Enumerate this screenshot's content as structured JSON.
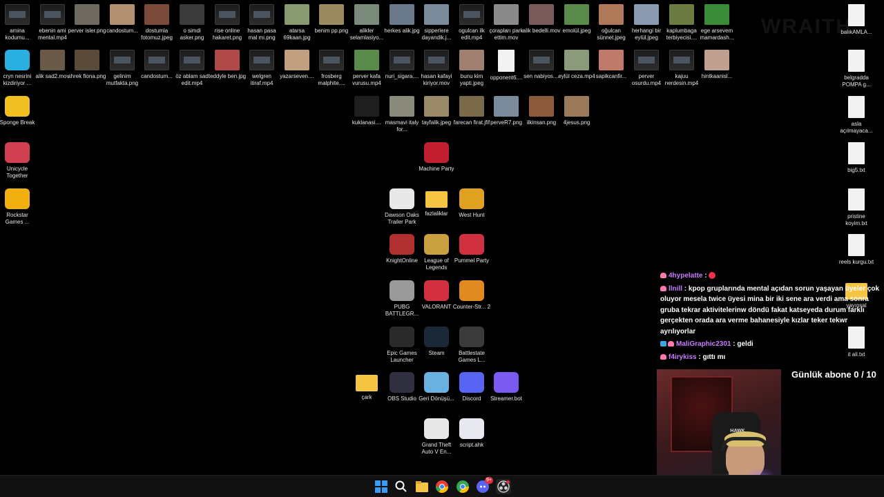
{
  "desktop_icons": [
    {
      "label": "amina kodumu...",
      "type": "vid",
      "color": ""
    },
    {
      "label": "ebenin ami mental.mp4",
      "type": "vid",
      "color": ""
    },
    {
      "label": "perver isler.png",
      "type": "photo",
      "color": "#6f6a60"
    },
    {
      "label": "candostum...",
      "type": "photo",
      "color": "#b09070"
    },
    {
      "label": "dostumla fotomuz.jpeg",
      "type": "photo",
      "color": "#7a4a3a"
    },
    {
      "label": "o simdi asker.png",
      "type": "photo",
      "color": "#3a3a3a"
    },
    {
      "label": "rise online hakaret.png",
      "type": "vid",
      "color": ""
    },
    {
      "label": "hasan pasa mal mi.png",
      "type": "vid",
      "color": ""
    },
    {
      "label": "atarsa 69kaan.jpg",
      "type": "photo",
      "color": "#8a9a70"
    },
    {
      "label": "benim pp.png",
      "type": "photo",
      "color": "#9a8a60"
    },
    {
      "label": "alikler selamlasiyo...",
      "type": "photo",
      "color": "#7a8a7a"
    },
    {
      "label": "herkes alik.jpg",
      "type": "photo",
      "color": "#6a7a8a"
    },
    {
      "label": "sipperlere dayandik.j...",
      "type": "photo",
      "color": "#7a8a9a"
    },
    {
      "label": "ogulcan ilk edit.mp4",
      "type": "vid",
      "color": ""
    },
    {
      "label": "çorapları park ettim.mov",
      "type": "photo",
      "color": "#8a8a8a"
    },
    {
      "label": "alik bedelli.mov",
      "type": "photo",
      "color": "#7a5a5a"
    },
    {
      "label": "emolül.jpeg",
      "type": "photo",
      "color": "#5a8a4a"
    },
    {
      "label": "oğulcan sünnet.jpeg",
      "type": "photo",
      "color": "#b07a5a"
    },
    {
      "label": "herhangi bir eylül.jpeg",
      "type": "photo",
      "color": "#8a9ab0"
    },
    {
      "label": "kaplumbaga terbiyecisi....",
      "type": "photo",
      "color": "#6a7a40"
    },
    {
      "label": "ege arsevem mamardash...",
      "type": "photo",
      "color": "#3a8a3a"
    },
    {
      "label": "cryn nesrini kizdiriyor ...",
      "type": "app",
      "color": "#2ab0e0"
    },
    {
      "label": "alik sad2.mov",
      "type": "photo",
      "color": "#6a5a4a"
    },
    {
      "label": "shrek fiona.png",
      "type": "photo",
      "color": "#5a4a3a"
    },
    {
      "label": "gelinim mutfakta.png",
      "type": "vid",
      "color": ""
    },
    {
      "label": "candostum...",
      "type": "vid",
      "color": ""
    },
    {
      "label": "öz ablam sad edit.mp4",
      "type": "vid",
      "color": ""
    },
    {
      "label": "teddyle ben.jpg",
      "type": "photo",
      "color": "#b04a4a"
    },
    {
      "label": "welgren itiraf.mp4",
      "type": "vid",
      "color": ""
    },
    {
      "label": "yazarseven....",
      "type": "photo",
      "color": "#c0a080"
    },
    {
      "label": "frosberg malphite....",
      "type": "vid",
      "color": ""
    },
    {
      "label": "perver kafa vurusu.mp4",
      "type": "photo",
      "color": "#5a8a4a"
    },
    {
      "label": "nuri_sigara....",
      "type": "vid",
      "color": ""
    },
    {
      "label": "hasan kafayi kiriyor.mov",
      "type": "vid",
      "color": ""
    },
    {
      "label": "bunu kim yapti.jpeg",
      "type": "photo",
      "color": "#a08070"
    },
    {
      "label": "opponent6....",
      "type": "txt",
      "color": ""
    },
    {
      "label": "sen nabiyos....",
      "type": "vid",
      "color": ""
    },
    {
      "label": "eylül ceza.mp4",
      "type": "photo",
      "color": "#8a9a7a"
    },
    {
      "label": "sapikcanfir...",
      "type": "photo",
      "color": "#c07a6a"
    },
    {
      "label": "perver osurdu.mp4",
      "type": "vid",
      "color": ""
    },
    {
      "label": "kajuu nerdesin.mp4",
      "type": "vid",
      "color": ""
    },
    {
      "label": "hintkaanisl...",
      "type": "photo",
      "color": "#c0a090"
    },
    {
      "label": "kuklanasi....",
      "type": "photo",
      "color": "#1e1e1e"
    },
    {
      "label": "masmavi italy for...",
      "type": "photo",
      "color": "#8a8a7a"
    },
    {
      "label": "tayfalik.jpeg",
      "type": "photo",
      "color": "#9a8a6a"
    },
    {
      "label": "farecan firat.jfif",
      "type": "photo",
      "color": "#7a6a4a"
    },
    {
      "label": "perveR7.png",
      "type": "photo",
      "color": "#7a8a9a"
    },
    {
      "label": "ilkinsan.png",
      "type": "photo",
      "color": "#8a5a3a"
    },
    {
      "label": "4jesus.png",
      "type": "photo",
      "color": "#9a7a5a"
    },
    {
      "label": "Sponge Break",
      "type": "app",
      "color": "#f0c020"
    },
    {
      "label": "Unicycle Together",
      "type": "app",
      "color": "#d04050"
    },
    {
      "label": "Rockstar Games ...",
      "type": "app",
      "color": "#f0b010"
    },
    {
      "label": "Machine Party",
      "type": "app",
      "color": "#c02030"
    },
    {
      "label": "Dawson Oaks Trailer Park",
      "type": "app",
      "color": "#e8e8e8"
    },
    {
      "label": "fazlaliklar",
      "type": "folder",
      "color": ""
    },
    {
      "label": "West Hunt",
      "type": "app",
      "color": "#e0a020"
    },
    {
      "label": "KnightOnline",
      "type": "app",
      "color": "#b03030"
    },
    {
      "label": "League of Legends",
      "type": "app",
      "color": "#c8a040"
    },
    {
      "label": "Pummel Party",
      "type": "app",
      "color": "#d03040"
    },
    {
      "label": "PUBG BATTLEGR...",
      "type": "app",
      "color": "#9a9a9a"
    },
    {
      "label": "VALORANT",
      "type": "app",
      "color": "#d03040"
    },
    {
      "label": "Counter-Str... 2",
      "type": "app",
      "color": "#e08a20"
    },
    {
      "label": "Epic Games Launcher",
      "type": "app",
      "color": "#2a2a2a"
    },
    {
      "label": "Steam",
      "type": "app",
      "color": "#1b2838"
    },
    {
      "label": "Battlestate Games L...",
      "type": "app",
      "color": "#3a3a3a"
    },
    {
      "label": "çark",
      "type": "folder",
      "color": ""
    },
    {
      "label": "OBS Studio",
      "type": "app",
      "color": "#303040"
    },
    {
      "label": "Geri Dönüşü...",
      "type": "app",
      "color": "#6ab0e0"
    },
    {
      "label": "Discord",
      "type": "app",
      "color": "#5865f2"
    },
    {
      "label": "Streamer.bot",
      "type": "app",
      "color": "#7a5af0"
    },
    {
      "label": "Grand Theft Auto V En...",
      "type": "app",
      "color": "#e8e8e8"
    },
    {
      "label": "script.ahk",
      "type": "app",
      "color": "#e8e8f0"
    },
    {
      "label": "balıkAMLA...",
      "type": "txt",
      "color": ""
    },
    {
      "label": "belgradda POMPA g...",
      "type": "txt",
      "color": ""
    },
    {
      "label": "asla açılmayaca...",
      "type": "txt",
      "color": ""
    },
    {
      "label": "big5.txt",
      "type": "txt",
      "color": ""
    },
    {
      "label": "pristine koyim.txt",
      "type": "txt",
      "color": ""
    },
    {
      "label": "reels kurgu.txt",
      "type": "txt",
      "color": ""
    },
    {
      "label": "yayınsal",
      "type": "folder",
      "color": ""
    },
    {
      "label": "it ali.txt",
      "type": "txt",
      "color": ""
    }
  ],
  "watermark": "WRAITH",
  "chat": [
    {
      "user": "4hypelatte",
      "sep": " :",
      "text": "",
      "color": "#c77dff"
    },
    {
      "user": "llnill",
      "sep": " :",
      "text": "kpop gruplarında mental açıdan sorun yaşayan üyeler çok oluyor mesela twice üyesi mina bir iki sene ara verdi ama sonra gruba tekrar aktivitelerinw döndü fakat katseyeda durum farklı gerçekten orada ara verme bahanesiyle kızlar teker tekwr ayrılıyorlar",
      "color": "#c77dff"
    },
    {
      "user": "MaliGraphic2301",
      "sep": " :",
      "text": "geldi",
      "color": "#c77dff"
    },
    {
      "user": "f4irykiss",
      "sep": " :",
      "text": "gıttı mı",
      "color": "#c77dff"
    }
  ],
  "sub_counter": "Günlük abone 0 / 10",
  "webcam": {
    "chair_brand": "HAWK"
  },
  "taskbar": {
    "items": [
      {
        "icon": "windows-start-icon",
        "color": "#3a9df5"
      },
      {
        "icon": "search-icon",
        "color": "#ffffff"
      },
      {
        "icon": "file-explorer-icon",
        "color": "#f6c443"
      },
      {
        "icon": "chrome-icon",
        "color": "#e94235"
      },
      {
        "icon": "chrome-icon",
        "color": "#34a853"
      },
      {
        "icon": "discord-icon",
        "color": "#5865f2"
      },
      {
        "icon": "obs-icon",
        "color": "#cfcfcf"
      }
    ],
    "discord_badge": "9+"
  }
}
